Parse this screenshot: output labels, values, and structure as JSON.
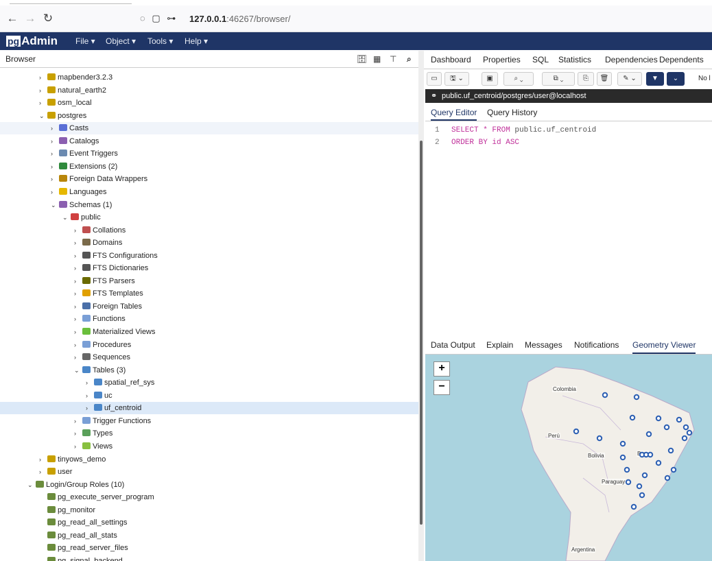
{
  "browser": {
    "url_host": "127.0.0.1",
    "url_rest": ":46267/browser/"
  },
  "app": {
    "logo_prefix": "pg",
    "logo_suffix": "Admin",
    "menu": [
      "File ▾",
      "Object ▾",
      "Tools ▾",
      "Help ▾"
    ]
  },
  "left_panel": {
    "title": "Browser",
    "tree": [
      {
        "label": "mapbender3.2.3",
        "level": 1,
        "arrow": "›",
        "icon": "db"
      },
      {
        "label": "natural_earth2",
        "level": 1,
        "arrow": "›",
        "icon": "db"
      },
      {
        "label": "osm_local",
        "level": 1,
        "arrow": "›",
        "icon": "db"
      },
      {
        "label": "postgres",
        "level": 1,
        "arrow": "⌄",
        "icon": "db"
      },
      {
        "label": "Casts",
        "level": 2,
        "arrow": "›",
        "icon": "cast",
        "state": "hover"
      },
      {
        "label": "Catalogs",
        "level": 2,
        "arrow": "›",
        "icon": "catalog"
      },
      {
        "label": "Event Triggers",
        "level": 2,
        "arrow": "›",
        "icon": "trigger"
      },
      {
        "label": "Extensions (2)",
        "level": 2,
        "arrow": "›",
        "icon": "ext"
      },
      {
        "label": "Foreign Data Wrappers",
        "level": 2,
        "arrow": "›",
        "icon": "fdw"
      },
      {
        "label": "Languages",
        "level": 2,
        "arrow": "›",
        "icon": "lang"
      },
      {
        "label": "Schemas (1)",
        "level": 2,
        "arrow": "⌄",
        "icon": "catalog"
      },
      {
        "label": "public",
        "level": 3,
        "arrow": "⌄",
        "icon": "schema"
      },
      {
        "label": "Collations",
        "level": 4,
        "arrow": "›",
        "icon": "collation"
      },
      {
        "label": "Domains",
        "level": 4,
        "arrow": "›",
        "icon": "domain"
      },
      {
        "label": "FTS Configurations",
        "level": 4,
        "arrow": "›",
        "icon": "fts"
      },
      {
        "label": "FTS Dictionaries",
        "level": 4,
        "arrow": "›",
        "icon": "fts"
      },
      {
        "label": "FTS Parsers",
        "level": 4,
        "arrow": "›",
        "icon": "parser"
      },
      {
        "label": "FTS Templates",
        "level": 4,
        "arrow": "›",
        "icon": "tmpl"
      },
      {
        "label": "Foreign Tables",
        "level": 4,
        "arrow": "›",
        "icon": "ftable"
      },
      {
        "label": "Functions",
        "level": 4,
        "arrow": "›",
        "icon": "func"
      },
      {
        "label": "Materialized Views",
        "level": 4,
        "arrow": "›",
        "icon": "mview"
      },
      {
        "label": "Procedures",
        "level": 4,
        "arrow": "›",
        "icon": "func"
      },
      {
        "label": "Sequences",
        "level": 4,
        "arrow": "›",
        "icon": "seq"
      },
      {
        "label": "Tables (3)",
        "level": 4,
        "arrow": "⌄",
        "icon": "table"
      },
      {
        "label": "spatial_ref_sys",
        "level": 5,
        "arrow": "›",
        "icon": "table"
      },
      {
        "label": "uc",
        "level": 5,
        "arrow": "›",
        "icon": "table"
      },
      {
        "label": "uf_centroid",
        "level": 5,
        "arrow": "›",
        "icon": "table",
        "state": "selected"
      },
      {
        "label": "Trigger Functions",
        "level": 4,
        "arrow": "›",
        "icon": "func"
      },
      {
        "label": "Types",
        "level": 4,
        "arrow": "›",
        "icon": "type"
      },
      {
        "label": "Views",
        "level": 4,
        "arrow": "›",
        "icon": "view"
      },
      {
        "label": "tinyows_demo",
        "level": 1,
        "arrow": "›",
        "icon": "db"
      },
      {
        "label": "user",
        "level": 1,
        "arrow": "›",
        "icon": "db"
      },
      {
        "label": "Login/Group Roles (10)",
        "level": 0,
        "arrow": "⌄",
        "icon": "group"
      },
      {
        "label": "pg_execute_server_program",
        "level": 1,
        "arrow": "",
        "icon": "group"
      },
      {
        "label": "pg_monitor",
        "level": 1,
        "arrow": "",
        "icon": "group"
      },
      {
        "label": "pg_read_all_settings",
        "level": 1,
        "arrow": "",
        "icon": "group"
      },
      {
        "label": "pg_read_all_stats",
        "level": 1,
        "arrow": "",
        "icon": "group"
      },
      {
        "label": "pg_read_server_files",
        "level": 1,
        "arrow": "",
        "icon": "group"
      },
      {
        "label": "pg_signal_backend",
        "level": 1,
        "arrow": "",
        "icon": "group"
      }
    ]
  },
  "right_panel": {
    "tabs": [
      "Dashboard",
      "Properties",
      "SQL",
      "Statistics",
      "Dependencies",
      "Dependents"
    ],
    "toolbar_tail": "No l",
    "connection": "public.uf_centroid/postgres/user@localhost",
    "query_tabs": [
      "Query Editor",
      "Query History"
    ],
    "code": {
      "l1_num": "1",
      "l1_kw1": "SELECT",
      "l1_op": " * ",
      "l1_kw2": "FROM",
      "l1_obj": " public.uf_centroid",
      "l2_num": "2",
      "l2_text": "ORDER BY id ASC"
    },
    "output_tabs": [
      "Data Output",
      "Explain",
      "Messages",
      "Notifications",
      "Geometry Viewer"
    ],
    "map": {
      "zoom_in": "+",
      "zoom_out": "−",
      "labels": {
        "colombia": "Colombia",
        "peru": "Perú",
        "bolivia": "Bolivia",
        "brazil": "Bras",
        "paraguay": "Paraguay",
        "argentina": "Argentina"
      },
      "accent": "#2c5fb3"
    }
  }
}
